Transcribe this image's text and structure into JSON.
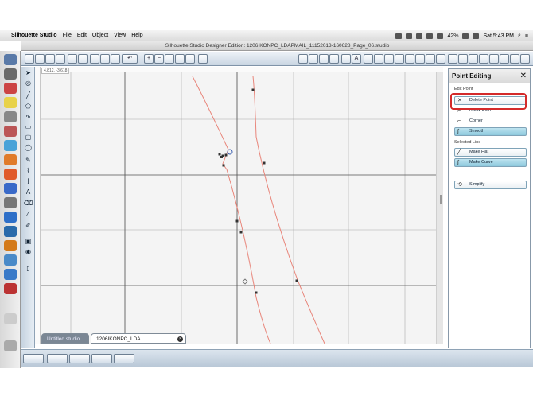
{
  "menubar": {
    "app_name": "Silhouette Studio",
    "menus": [
      "File",
      "Edit",
      "Object",
      "View",
      "Help"
    ],
    "battery": "42%",
    "clock": "Sat 5:43 PM"
  },
  "window": {
    "title": "Silhouette Studio Designer Edition: 1206IKONPC_LDAPMAIL_11152013-160628_Page_06.studio"
  },
  "canvas": {
    "coord_readout": "4.812, -3.618"
  },
  "doc_tabs": {
    "inactive_label": "Untitled.studio",
    "active_label": "1206IKONPC_LDA..."
  },
  "panel": {
    "title": "Point Editing",
    "close_symbol": "✕",
    "section_point": "Edit Point",
    "delete_point": "Delete Point",
    "break_path": "Break Path",
    "corner": "Corner",
    "smooth": "Smooth",
    "section_line": "Selected Line",
    "make_flat": "Make Flat",
    "make_curve": "Make Curve",
    "simplify": "Simplify"
  },
  "colors": {
    "path": "#e8857a",
    "highlight": "#d42a2a",
    "selected_button": "#8dc8dc"
  }
}
